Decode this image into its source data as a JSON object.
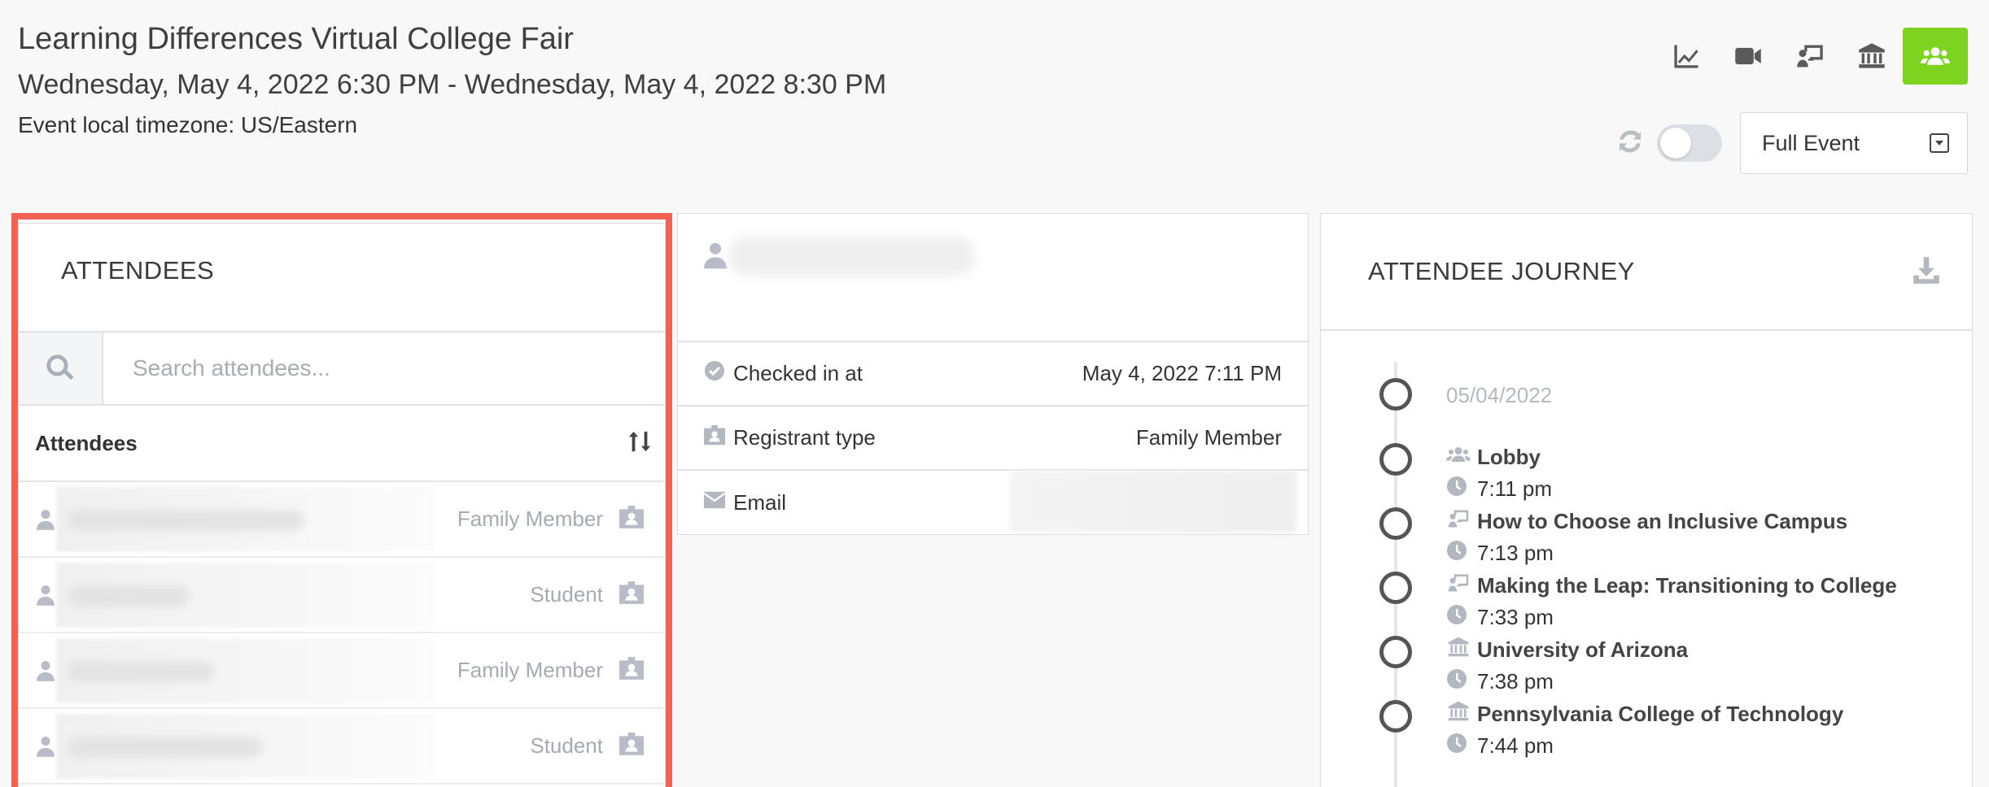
{
  "event": {
    "title": "Learning Differences Virtual College Fair",
    "dates": "Wednesday, May 4, 2022 6:30 PM - Wednesday, May 4, 2022 8:30 PM",
    "timezone": "Event local timezone: US/Eastern"
  },
  "toolbar": {
    "icons": [
      "chart-line-icon",
      "video-icon",
      "presentation-icon",
      "institution-icon",
      "users-icon"
    ],
    "active": "users-icon",
    "active_color": "#7ed321"
  },
  "controls": {
    "view_select": "Full Event"
  },
  "attendees": {
    "heading": "ATTENDEES",
    "search_placeholder": "Search attendees...",
    "column_label": "Attendees",
    "rows": [
      {
        "type": "Family Member"
      },
      {
        "type": "Student"
      },
      {
        "type": "Family Member"
      },
      {
        "type": "Student"
      }
    ]
  },
  "details": {
    "checked_in_label": "Checked in at",
    "checked_in_value": "May 4, 2022 7:11 PM",
    "registrant_label": "Registrant type",
    "registrant_value": "Family Member",
    "email_label": "Email"
  },
  "journey": {
    "heading": "ATTENDEE JOURNEY",
    "date": "05/04/2022",
    "items": [
      {
        "icon": "users-icon",
        "name": "Lobby",
        "time": "7:11 pm"
      },
      {
        "icon": "presentation-icon",
        "name": "How to Choose an Inclusive Campus",
        "time": "7:13 pm"
      },
      {
        "icon": "presentation-icon",
        "name": "Making the Leap: Transitioning to College",
        "time": "7:33 pm"
      },
      {
        "icon": "institution-icon",
        "name": "University of Arizona",
        "time": "7:38 pm"
      },
      {
        "icon": "institution-icon",
        "name": "Pennsylvania College of Technology",
        "time": "7:44 pm"
      }
    ]
  },
  "highlight_color": "#f26152"
}
